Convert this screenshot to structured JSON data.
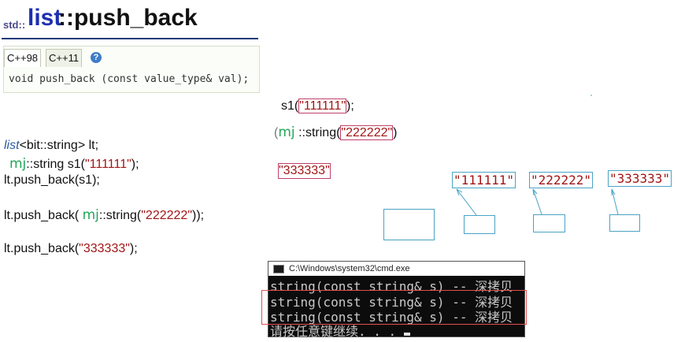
{
  "header": {
    "ns": "std::",
    "list": "list",
    "rest": "::push_back"
  },
  "declaration": {
    "tabs": [
      "C++98",
      "C++11"
    ],
    "help_icon": "?",
    "text": "void push_back (const value_type& val);"
  },
  "annotations": {
    "s1_prefix": "s1(",
    "s1_str": "\"111111\"",
    "s1_suffix": ");",
    "mj_label": "mj",
    "string_open": "::string(",
    "str2": "\"222222\"",
    "close": ")",
    "str3": "\"333333\""
  },
  "code": {
    "line1_kw": "list",
    "line1_rest": "<bit::string> lt;",
    "line2_mj": "mj",
    "line2_rest": "::string s1(",
    "line2_str": "\"111111\"",
    "line2_end": ");",
    "line3": "lt.push_back(s1);",
    "line4_start": "lt.push_back( ",
    "line4_mj": "mj",
    "line4_mid": "::string(",
    "line4_str": "\"222222\"",
    "line4_end": "));",
    "line5_start": "lt.push_back(",
    "line5_str": "\"333333\"",
    "line5_end": ");"
  },
  "diagram": {
    "nodes": [
      "\"111111\"",
      "\"222222\"",
      "\"333333\""
    ]
  },
  "cmd": {
    "title": "C:\\Windows\\system32\\cmd.exe",
    "lines": [
      "string(const string& s) -- 深拷贝",
      "string(const string& s) -- 深拷贝",
      "string(const string& s) -- 深拷贝",
      "请按任意键继续. . . "
    ]
  },
  "colors": {
    "accent": "#1c2fb0",
    "string": "#a31515",
    "mj": "#24a65a",
    "node_border": "#4aa3c4"
  }
}
